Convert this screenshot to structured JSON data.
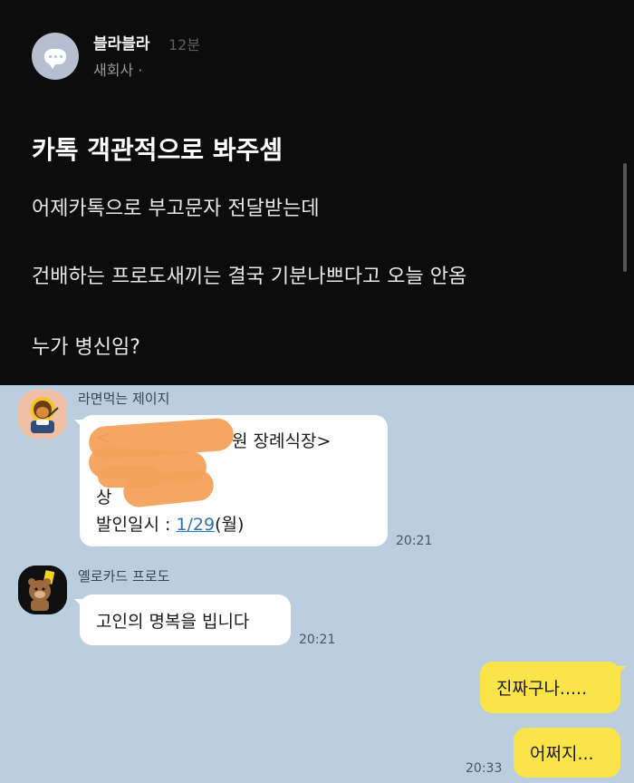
{
  "post": {
    "author": "블라블라",
    "time": "12분",
    "company": "새회사 ·",
    "title": "카톡 객관적으로 봐주셈",
    "lines": [
      "어제카톡으로 부고문자 전달받는데",
      "건배하는 프로도새끼는 결국 기분나쁘다고 오늘 안옴",
      "누가 병신임?"
    ]
  },
  "chat": {
    "messages": [
      {
        "sender": "라면먹는 제이지",
        "lines": [
          "<",
          "원 장례식장>",
          "상",
          "발인일시 : "
        ],
        "date_link": "1/29",
        "date_suffix": "(월)",
        "time": "20:21"
      },
      {
        "sender": "옐로카드 프로도",
        "text": "고인의 명복을 빕니다",
        "time": "20:21"
      }
    ],
    "my_messages": [
      {
        "text": "진짜구나....."
      },
      {
        "text": "어쩌지..."
      }
    ],
    "my_time": "20:33"
  },
  "colors": {
    "post_background": "#0c0c0c",
    "chat_background": "#bacee0",
    "my_bubble": "#fbe44a",
    "other_bubble": "#ffffff",
    "redaction": "#f4a25c",
    "link": "#2f6fb4"
  }
}
